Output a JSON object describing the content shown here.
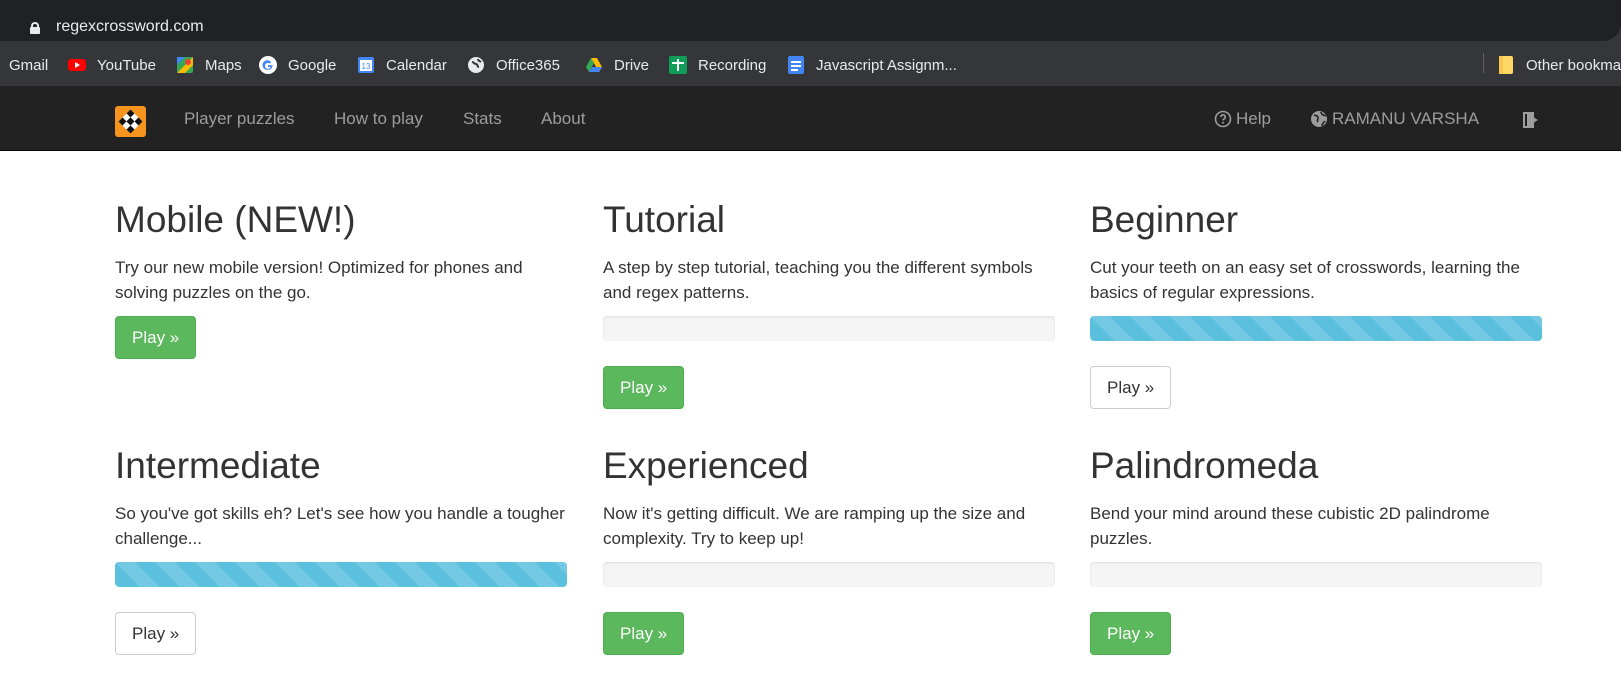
{
  "browser": {
    "url": "regexcrossword.com",
    "bookmarks": [
      {
        "label": "Gmail",
        "icon": "gmail-icon"
      },
      {
        "label": "YouTube",
        "icon": "youtube-icon"
      },
      {
        "label": "Maps",
        "icon": "maps-icon"
      },
      {
        "label": "Google",
        "icon": "google-icon"
      },
      {
        "label": "Calendar",
        "icon": "calendar-icon"
      },
      {
        "label": "Office365",
        "icon": "globe-icon"
      },
      {
        "label": "Drive",
        "icon": "drive-icon"
      },
      {
        "label": "Recording",
        "icon": "sheets-icon"
      },
      {
        "label": "Javascript Assignm...",
        "icon": "docs-icon"
      }
    ],
    "calendar_day": "13",
    "other_bookmarks": "Other bookma"
  },
  "nav": {
    "links": [
      "Player puzzles",
      "How to play",
      "Stats",
      "About"
    ],
    "help": "Help",
    "user": "RAMANU VARSHA"
  },
  "cards": [
    {
      "title": "Mobile (NEW!)",
      "description": "Try our new mobile version! Optimized for phones and solving puzzles on the go.",
      "has_progress": false,
      "button": "Play »",
      "button_style": "success"
    },
    {
      "title": "Tutorial",
      "description": "A step by step tutorial, teaching you the different symbols and regex patterns.",
      "has_progress": true,
      "progress": 0,
      "button": "Play »",
      "button_style": "success"
    },
    {
      "title": "Beginner",
      "description": "Cut your teeth on an easy set of crosswords, learning the basics of regular expressions.",
      "has_progress": true,
      "progress": 100,
      "button": "Play »",
      "button_style": "default"
    },
    {
      "title": "Intermediate",
      "description": "So you've got skills eh? Let's see how you handle a tougher challenge...",
      "has_progress": true,
      "progress": 100,
      "button": "Play »",
      "button_style": "default"
    },
    {
      "title": "Experienced",
      "description": "Now it's getting difficult. We are ramping up the size and complexity. Try to keep up!",
      "has_progress": true,
      "progress": 0,
      "button": "Play »",
      "button_style": "success"
    },
    {
      "title": "Palindromeda",
      "description": "Bend your mind around these cubistic 2D palindrome puzzles.",
      "has_progress": true,
      "progress": 0,
      "button": "Play »",
      "button_style": "success"
    }
  ],
  "colors": {
    "success": "#5cb85c",
    "progress_info": "#5bc0de",
    "navbar": "#222222",
    "logo": "#f7941d"
  }
}
